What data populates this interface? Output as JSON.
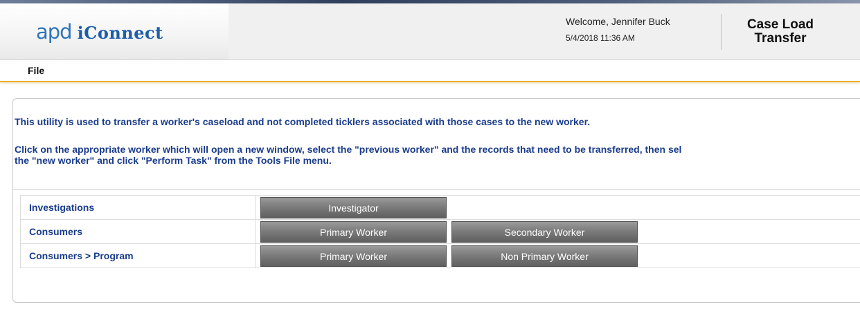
{
  "header": {
    "logo_prefix": "apd",
    "logo_name": "iConnect",
    "welcome": "Welcome, Jennifer Buck",
    "timestamp": "5/4/2018 11:36 AM",
    "page_title": "Case Load Transfer"
  },
  "menu": {
    "file": "File"
  },
  "instructions": {
    "line1": "This utility is used to transfer a worker's caseload and not completed ticklers associated with those cases to the new worker.",
    "line2": "Click on the appropriate worker which will open a new window, select the \"previous worker\" and the records that need to be transferred, then sel",
    "line3": "the \"new worker\" and click \"Perform Task\" from the Tools File menu."
  },
  "rows": [
    {
      "label": "Investigations",
      "buttons": [
        "Investigator"
      ]
    },
    {
      "label": "Consumers",
      "buttons": [
        "Primary Worker",
        "Secondary Worker"
      ]
    },
    {
      "label": "Consumers > Program",
      "buttons": [
        "Primary Worker",
        "Non Primary Worker"
      ]
    }
  ],
  "colors": {
    "brand_blue": "#1d5eaa",
    "text_blue": "#1a3c8c",
    "accent_gold": "#e8b02a",
    "button_gray": "#6e6e6e"
  }
}
